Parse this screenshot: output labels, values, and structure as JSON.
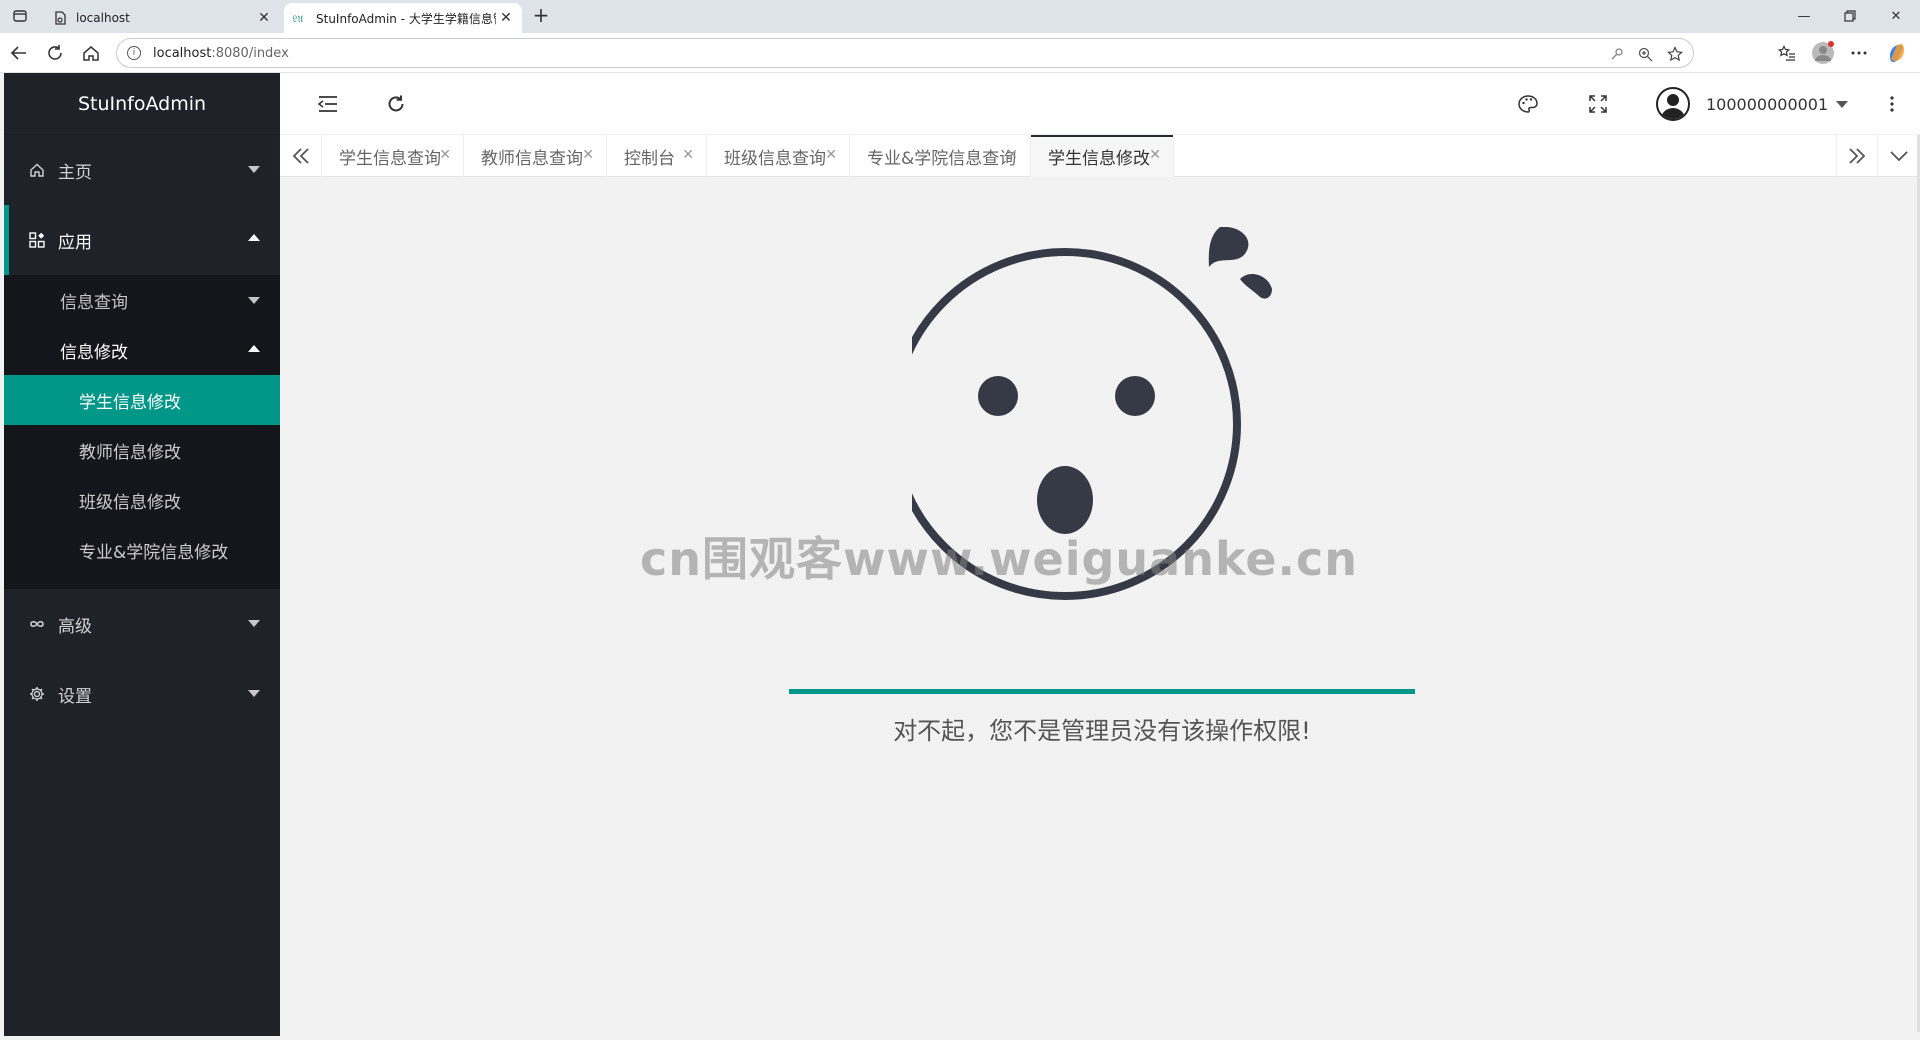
{
  "browser": {
    "tabs": [
      {
        "title": "localhost",
        "active": false
      },
      {
        "title": "StuInfoAdmin - 大学生学籍信息管",
        "active": true
      }
    ],
    "address": {
      "host": "localhost",
      "rest": ":8080/index"
    }
  },
  "app": {
    "logo": "StuInfoAdmin",
    "menu": [
      {
        "label": "主页",
        "icon": "home-icon",
        "open": false
      },
      {
        "label": "应用",
        "icon": "apps-icon",
        "open": true
      },
      {
        "label": "高级",
        "icon": "infinity-icon",
        "open": false
      },
      {
        "label": "设置",
        "icon": "gear-icon",
        "open": false
      }
    ],
    "submenu": {
      "query": "信息查询",
      "edit": "信息修改",
      "edit_items": [
        "学生信息修改",
        "教师信息修改",
        "班级信息修改",
        "专业&学院信息修改"
      ]
    },
    "header": {
      "user": "100000000001"
    },
    "page_tabs": [
      "学生信息查询",
      "教师信息查询",
      "控制台",
      "班级信息查询",
      "专业&学院信息查询",
      "学生信息修改"
    ],
    "active_tab": "学生信息修改",
    "error_message": "对不起，您不是管理员没有该操作权限!",
    "watermark": "cn围观客www.weiguanke.cn",
    "accent_color": "#009688",
    "sidebar_color": "#20222a"
  }
}
